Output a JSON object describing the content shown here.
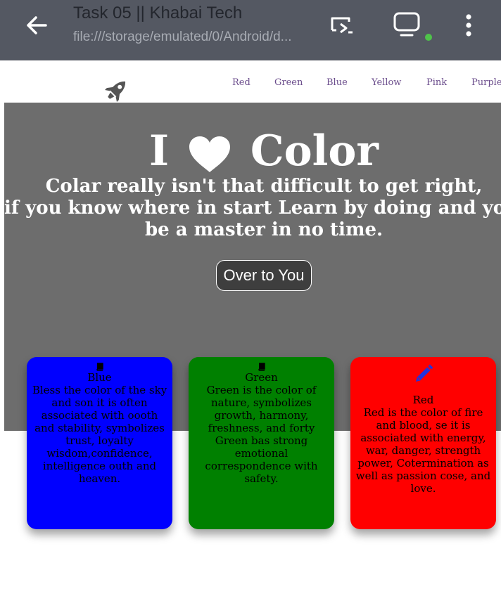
{
  "browser": {
    "page_name": "Task 05 || Khabai Tech",
    "url": "file:///storage/emulated/0/Android/d..."
  },
  "nav": {
    "links": [
      "Red",
      "Green",
      "Blue",
      "Yellow",
      "Pink",
      "Purple"
    ]
  },
  "hero": {
    "title_before": "I",
    "title_after": "Color",
    "text_lines": [
      "Colar really isn't that difficult to get right,",
      "if you know where in start Learn by doing and you'l",
      "be a master in no time."
    ],
    "button_label": "Over to You"
  },
  "cards": [
    {
      "title": "Blue",
      "icon": "book-icon",
      "color": "#0000ff",
      "text": "Bless the color of the sky and son it is often associated with oooth and stability, symbolizes trust, loyalty wisdom,confidence, intelligence outh and heaven."
    },
    {
      "title": "Green",
      "icon": "book-icon",
      "color": "#008000",
      "text": "Green is the color of nature, symbolizes growth, harmony, freshness, and forty Green bas strong emotional correspondence with safety."
    },
    {
      "title": "Red",
      "icon": "pencil-icon",
      "color": "#ff0000",
      "text": "Red is the color of fire and blood, se it is associated with energy, war, danger, strength power, Cotermination as well as passion cose, and love."
    }
  ],
  "colors": {
    "topbar": "#545862",
    "hero": "#6d6d6d",
    "nav_link": "#6b4d8c",
    "status_dot": "#4fc34a"
  }
}
